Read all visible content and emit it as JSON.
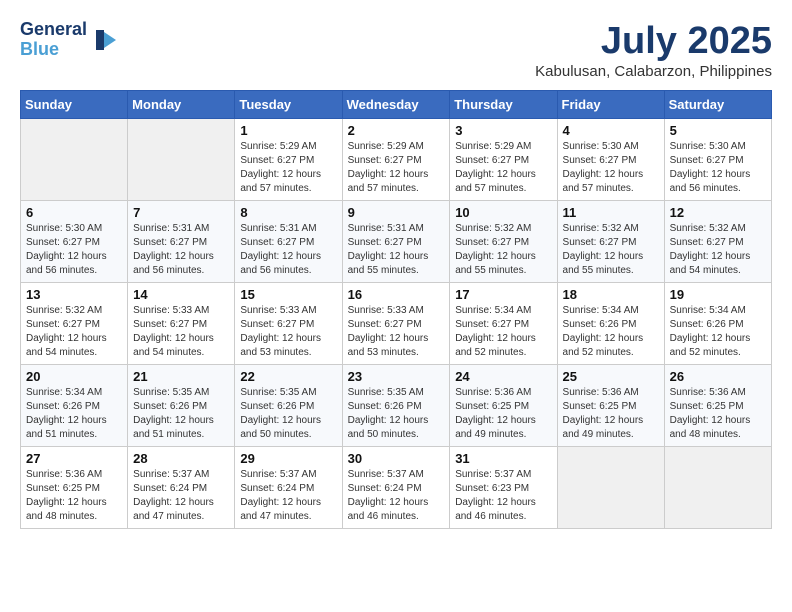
{
  "header": {
    "logo_line1": "General",
    "logo_line2": "Blue",
    "month": "July 2025",
    "location": "Kabulusan, Calabarzon, Philippines"
  },
  "weekdays": [
    "Sunday",
    "Monday",
    "Tuesday",
    "Wednesday",
    "Thursday",
    "Friday",
    "Saturday"
  ],
  "weeks": [
    [
      {
        "day": "",
        "empty": true
      },
      {
        "day": "",
        "empty": true
      },
      {
        "day": "1",
        "info": "Sunrise: 5:29 AM\nSunset: 6:27 PM\nDaylight: 12 hours and 57 minutes."
      },
      {
        "day": "2",
        "info": "Sunrise: 5:29 AM\nSunset: 6:27 PM\nDaylight: 12 hours and 57 minutes."
      },
      {
        "day": "3",
        "info": "Sunrise: 5:29 AM\nSunset: 6:27 PM\nDaylight: 12 hours and 57 minutes."
      },
      {
        "day": "4",
        "info": "Sunrise: 5:30 AM\nSunset: 6:27 PM\nDaylight: 12 hours and 57 minutes."
      },
      {
        "day": "5",
        "info": "Sunrise: 5:30 AM\nSunset: 6:27 PM\nDaylight: 12 hours and 56 minutes."
      }
    ],
    [
      {
        "day": "6",
        "info": "Sunrise: 5:30 AM\nSunset: 6:27 PM\nDaylight: 12 hours and 56 minutes."
      },
      {
        "day": "7",
        "info": "Sunrise: 5:31 AM\nSunset: 6:27 PM\nDaylight: 12 hours and 56 minutes."
      },
      {
        "day": "8",
        "info": "Sunrise: 5:31 AM\nSunset: 6:27 PM\nDaylight: 12 hours and 56 minutes."
      },
      {
        "day": "9",
        "info": "Sunrise: 5:31 AM\nSunset: 6:27 PM\nDaylight: 12 hours and 55 minutes."
      },
      {
        "day": "10",
        "info": "Sunrise: 5:32 AM\nSunset: 6:27 PM\nDaylight: 12 hours and 55 minutes."
      },
      {
        "day": "11",
        "info": "Sunrise: 5:32 AM\nSunset: 6:27 PM\nDaylight: 12 hours and 55 minutes."
      },
      {
        "day": "12",
        "info": "Sunrise: 5:32 AM\nSunset: 6:27 PM\nDaylight: 12 hours and 54 minutes."
      }
    ],
    [
      {
        "day": "13",
        "info": "Sunrise: 5:32 AM\nSunset: 6:27 PM\nDaylight: 12 hours and 54 minutes."
      },
      {
        "day": "14",
        "info": "Sunrise: 5:33 AM\nSunset: 6:27 PM\nDaylight: 12 hours and 54 minutes."
      },
      {
        "day": "15",
        "info": "Sunrise: 5:33 AM\nSunset: 6:27 PM\nDaylight: 12 hours and 53 minutes."
      },
      {
        "day": "16",
        "info": "Sunrise: 5:33 AM\nSunset: 6:27 PM\nDaylight: 12 hours and 53 minutes."
      },
      {
        "day": "17",
        "info": "Sunrise: 5:34 AM\nSunset: 6:27 PM\nDaylight: 12 hours and 52 minutes."
      },
      {
        "day": "18",
        "info": "Sunrise: 5:34 AM\nSunset: 6:26 PM\nDaylight: 12 hours and 52 minutes."
      },
      {
        "day": "19",
        "info": "Sunrise: 5:34 AM\nSunset: 6:26 PM\nDaylight: 12 hours and 52 minutes."
      }
    ],
    [
      {
        "day": "20",
        "info": "Sunrise: 5:34 AM\nSunset: 6:26 PM\nDaylight: 12 hours and 51 minutes."
      },
      {
        "day": "21",
        "info": "Sunrise: 5:35 AM\nSunset: 6:26 PM\nDaylight: 12 hours and 51 minutes."
      },
      {
        "day": "22",
        "info": "Sunrise: 5:35 AM\nSunset: 6:26 PM\nDaylight: 12 hours and 50 minutes."
      },
      {
        "day": "23",
        "info": "Sunrise: 5:35 AM\nSunset: 6:26 PM\nDaylight: 12 hours and 50 minutes."
      },
      {
        "day": "24",
        "info": "Sunrise: 5:36 AM\nSunset: 6:25 PM\nDaylight: 12 hours and 49 minutes."
      },
      {
        "day": "25",
        "info": "Sunrise: 5:36 AM\nSunset: 6:25 PM\nDaylight: 12 hours and 49 minutes."
      },
      {
        "day": "26",
        "info": "Sunrise: 5:36 AM\nSunset: 6:25 PM\nDaylight: 12 hours and 48 minutes."
      }
    ],
    [
      {
        "day": "27",
        "info": "Sunrise: 5:36 AM\nSunset: 6:25 PM\nDaylight: 12 hours and 48 minutes."
      },
      {
        "day": "28",
        "info": "Sunrise: 5:37 AM\nSunset: 6:24 PM\nDaylight: 12 hours and 47 minutes."
      },
      {
        "day": "29",
        "info": "Sunrise: 5:37 AM\nSunset: 6:24 PM\nDaylight: 12 hours and 47 minutes."
      },
      {
        "day": "30",
        "info": "Sunrise: 5:37 AM\nSunset: 6:24 PM\nDaylight: 12 hours and 46 minutes."
      },
      {
        "day": "31",
        "info": "Sunrise: 5:37 AM\nSunset: 6:23 PM\nDaylight: 12 hours and 46 minutes."
      },
      {
        "day": "",
        "empty": true
      },
      {
        "day": "",
        "empty": true
      }
    ]
  ]
}
